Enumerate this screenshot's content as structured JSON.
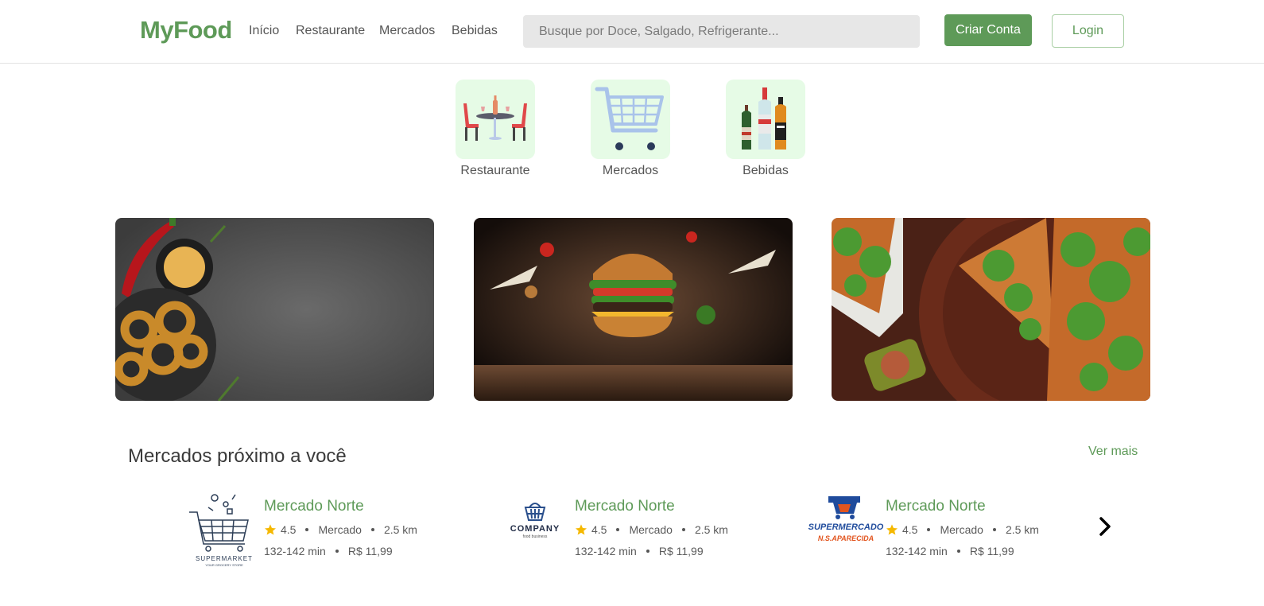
{
  "header": {
    "logo": "MyFood",
    "nav": [
      {
        "label": "Início"
      },
      {
        "label": "Restaurante"
      },
      {
        "label": "Mercados"
      },
      {
        "label": "Bebidas"
      }
    ],
    "search_placeholder": "Busque por Doce, Salgado, Refrigerante...",
    "signup_label": "Criar Conta",
    "login_label": "Login"
  },
  "categories": [
    {
      "label": "Restaurante",
      "icon": "restaurant-table-icon"
    },
    {
      "label": "Mercados",
      "icon": "shopping-cart-icon"
    },
    {
      "label": "Bebidas",
      "icon": "bottles-icon"
    }
  ],
  "banners": [
    {
      "name": "banner-appetizers"
    },
    {
      "name": "banner-burger"
    },
    {
      "name": "banner-pizza"
    }
  ],
  "section": {
    "title": "Mercados próximo a você",
    "see_more": "Ver mais"
  },
  "markets": [
    {
      "name": "Mercado Norte",
      "rating": "4.5",
      "type": "Mercado",
      "distance": "2.5 km",
      "time": "132-142 min",
      "fee": "R$ 11,99",
      "logo_text": "SUPERMARKET",
      "logo_sub": "YOUR GROCERY STORE"
    },
    {
      "name": "Mercado Norte",
      "rating": "4.5",
      "type": "Mercado",
      "distance": "2.5 km",
      "time": "132-142 min",
      "fee": "R$ 11,99",
      "logo_text": "COMPANY",
      "logo_sub": "food business"
    },
    {
      "name": "Mercado Norte",
      "rating": "4.5",
      "type": "Mercado",
      "distance": "2.5 km",
      "time": "132-142 min",
      "fee": "R$ 11,99",
      "logo_text": "SUPERMERCADO",
      "logo_sub": "N.S.APARECIDA"
    }
  ],
  "colors": {
    "brand_green": "#5e9a58",
    "category_bg": "#e6fbe6",
    "star": "#f5b800"
  }
}
